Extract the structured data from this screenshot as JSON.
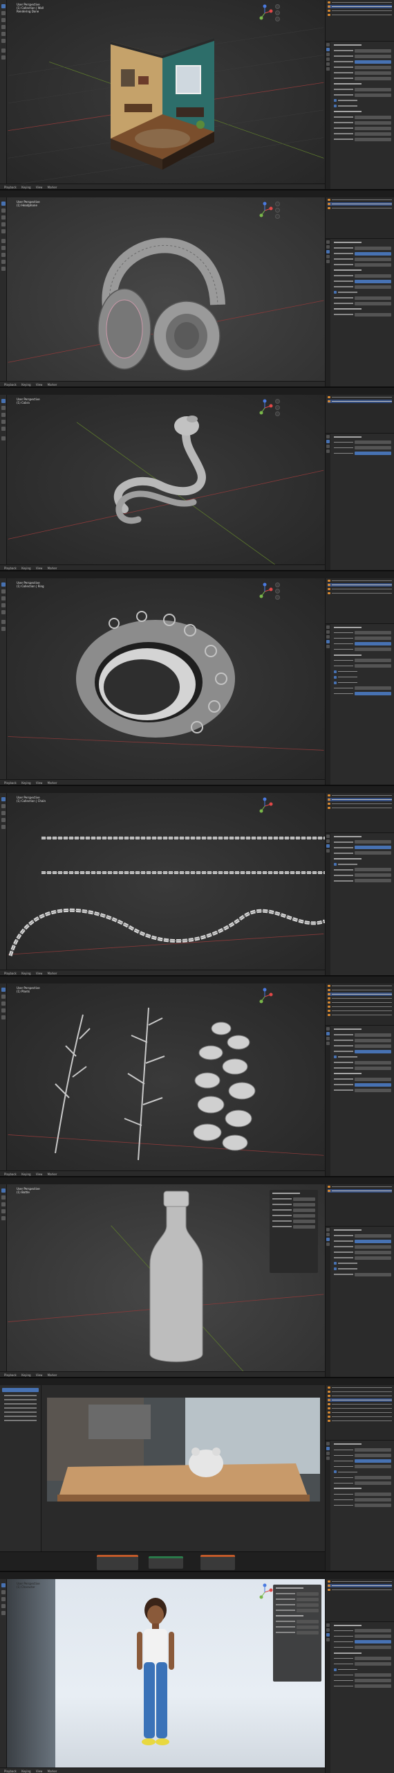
{
  "panels": [
    {
      "id": "diorama",
      "info": [
        "User Perspective",
        "(1) Collection | Wall",
        "Rendering Done"
      ],
      "timeline": [
        "Playback",
        "Keying",
        "View",
        "Marker"
      ]
    },
    {
      "id": "headphones",
      "info": [
        "User Perspective",
        "(1) Headphone"
      ],
      "timeline": [
        "Playback",
        "Keying",
        "View",
        "Marker"
      ]
    },
    {
      "id": "cobra",
      "info": [
        "User Perspective",
        "(1) Cobra"
      ],
      "timeline": [
        "Playback",
        "Keying",
        "View",
        "Marker"
      ]
    },
    {
      "id": "ring",
      "info": [
        "User Perspective",
        "(1) Collection | Ring"
      ],
      "timeline": [
        "Playback",
        "Keying",
        "View",
        "Marker"
      ]
    },
    {
      "id": "chain",
      "info": [
        "User Perspective",
        "(1) Collection | Chain"
      ],
      "timeline": [
        "Playback",
        "Keying",
        "View",
        "Marker"
      ]
    },
    {
      "id": "plants",
      "info": [
        "User Perspective",
        "(1) Plants"
      ],
      "timeline": [
        "Playback",
        "Keying",
        "View",
        "Marker"
      ]
    },
    {
      "id": "bottle",
      "info": [
        "User Perspective",
        "(1) Bottle"
      ],
      "timeline": [
        "Playback",
        "Keying",
        "View",
        "Marker"
      ]
    },
    {
      "id": "render",
      "info": [],
      "timeline": [
        "View",
        "Image"
      ]
    },
    {
      "id": "character",
      "info": [
        "User Perspective",
        "(1) Character"
      ],
      "timeline": [
        "Playback",
        "Keying",
        "View",
        "Marker"
      ]
    }
  ],
  "colors": {
    "accent": "#4772b3",
    "select": "#d98a32",
    "viewport": "#3d3d3d"
  }
}
